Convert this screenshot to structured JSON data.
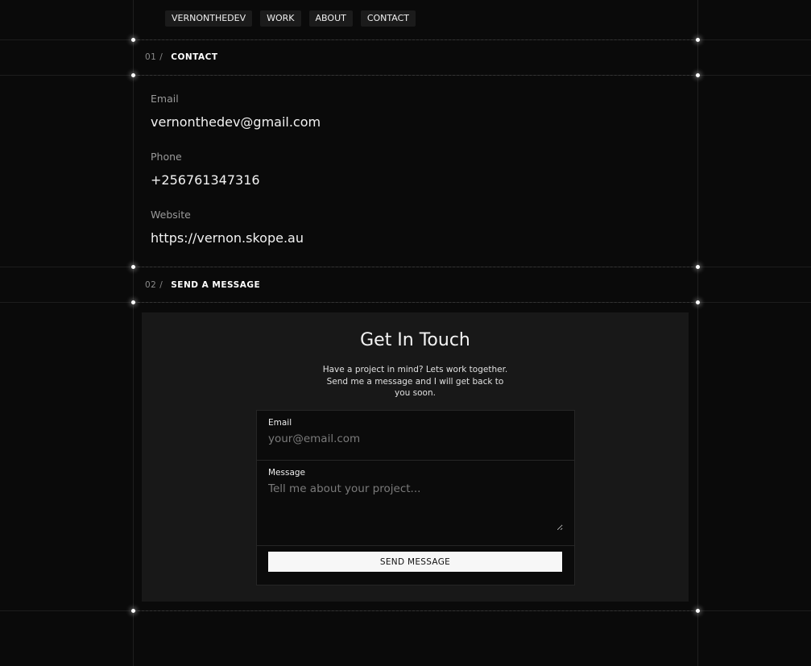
{
  "nav": {
    "items": [
      "VERNONTHEDEV",
      "WORK",
      "ABOUT",
      "CONTACT"
    ]
  },
  "sections": [
    {
      "number": "01 /",
      "title": "CONTACT"
    },
    {
      "number": "02 /",
      "title": "SEND A MESSAGE"
    }
  ],
  "contact": {
    "email_label": "Email",
    "email_value": "vernonthedev@gmail.com",
    "phone_label": "Phone",
    "phone_value": "+256761347316",
    "website_label": "Website",
    "website_value": "https://vernon.skope.au"
  },
  "form_card": {
    "title": "Get In Touch",
    "subtitle": "Have a project in mind? Lets work together. Send me a message and I will get back to you soon.",
    "email_label": "Email",
    "email_placeholder": "your@email.com",
    "message_label": "Message",
    "message_placeholder": "Tell me about your project...",
    "send_label": "SEND MESSAGE"
  },
  "colors": {
    "background": "#0a0a0a",
    "card": "#181818",
    "button": "#f7f7f7",
    "text": "#f2f2f2",
    "muted": "#9a9a9a"
  }
}
